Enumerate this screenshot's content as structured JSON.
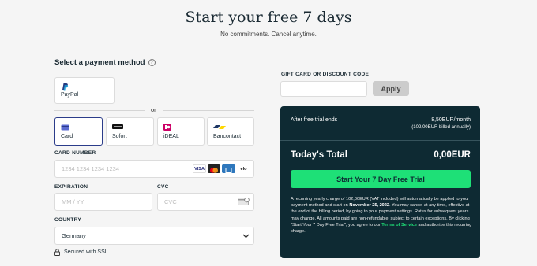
{
  "header": {
    "title": "Start your free 7 days",
    "subtitle": "No commitments. Cancel anytime."
  },
  "payment": {
    "title": "Select a payment method",
    "help_icon": "?",
    "paypal_label": "PayPal",
    "or_text": "or",
    "methods": [
      {
        "label": "Card",
        "icon": "card-icon",
        "selected": true
      },
      {
        "label": "Sofort",
        "icon": "sofort-icon",
        "selected": false
      },
      {
        "label": "iDEAL",
        "icon": "ideal-icon",
        "selected": false
      },
      {
        "label": "Bancontact",
        "icon": "bancontact-icon",
        "selected": false
      }
    ],
    "card_number_label": "CARD NUMBER",
    "card_number_placeholder": "1234 1234 1234 1234",
    "card_brands": [
      "VISA",
      "mastercard",
      "amex",
      "elo"
    ],
    "expiration_label": "EXPIRATION",
    "expiration_placeholder": "MM / YY",
    "cvc_label": "CVC",
    "cvc_placeholder": "CVC",
    "country_label": "COUNTRY",
    "country_value": "Germany",
    "secure_text": "Secured with SSL"
  },
  "gift": {
    "label": "GIFT CARD OR DISCOUNT CODE",
    "apply_label": "Apply"
  },
  "summary": {
    "after_trial_label": "After free trial ends",
    "price": "8,50EUR/month",
    "billed": "(102,00EUR billed annually)",
    "total_label": "Today's Total",
    "total_value": "0,00EUR",
    "cta_label": "Start Your 7 Day Free Trial",
    "fine_1": "A recurring yearly charge of 102,00EUR (VAT included) will automatically be applied to your payment method and start on ",
    "fine_date": "November 25, 2022",
    "fine_2": ". You may cancel at any time, effective at the end of the billing period, by going to your payment settings. Rates for subsequent years may change. All amounts paid are non-refundable, subject to certain exceptions. By clicking \"Start Your 7 Day Free Trial\", you agree to our ",
    "fine_tos": "Terms of Service",
    "fine_3": " and authorize this recurring charge."
  },
  "colors": {
    "accent": "#1ee077",
    "panel": "#0e2a33",
    "selected_border": "#2b3c8a"
  }
}
